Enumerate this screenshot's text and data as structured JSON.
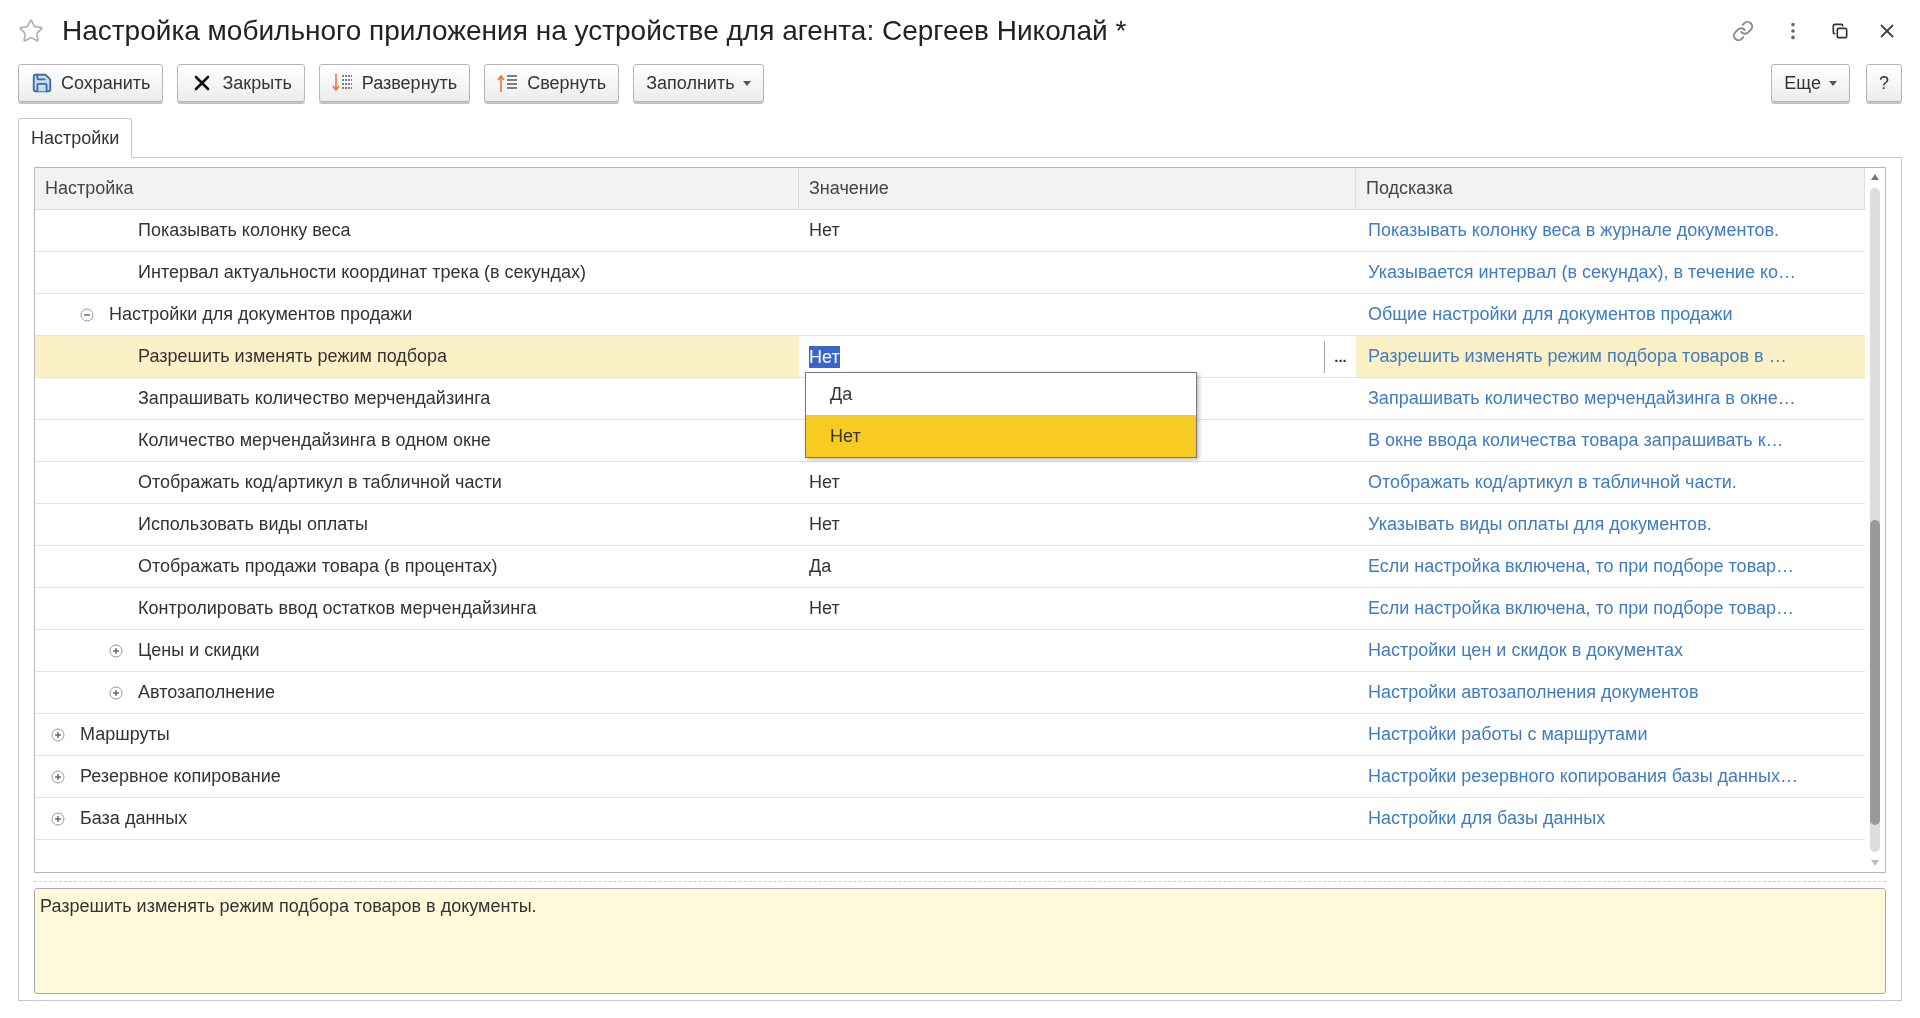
{
  "window": {
    "title": "Настройка мобильного приложения на устройстве для агента: Сергеев Николай *"
  },
  "toolbar": {
    "left": [
      {
        "kind": "save",
        "label": "Сохранить"
      },
      {
        "kind": "close",
        "label": "Закрыть"
      },
      {
        "kind": "expand",
        "label": "Развернуть"
      },
      {
        "kind": "collapse",
        "label": "Свернуть"
      },
      {
        "kind": "menu",
        "label": "Заполнить"
      }
    ],
    "right": [
      {
        "kind": "menu",
        "label": "Еще"
      },
      {
        "kind": "plain",
        "label": "?"
      }
    ]
  },
  "tabs": [
    {
      "label": "Настройки",
      "selected": true
    }
  ],
  "table": {
    "columns": [
      "Настройка",
      "Значение",
      "Подсказка"
    ],
    "rows": [
      {
        "children": [
          {
            "children": [
              {
                "setting": "Показывать колонку веса",
                "value": "Нет",
                "hint": "Показывать колонку веса в журнале документов.",
                "selected": false
              },
              {
                "setting": "Интервал актуальности координат трека (в секундах)",
                "hint": "Указывается интервал (в секундах), в течение ко…",
                "selected": false
              }
            ]
          },
          {
            "setting": "Настройки для документов продажи",
            "hint": "Общие настройки для документов продажи",
            "expanded": true,
            "selected": false,
            "children": [
              {
                "setting": "Разрешить изменять режим подбора",
                "value": "Нет",
                "hint": "Разрешить изменять режим подбора товаров в …",
                "selected": true,
                "editor": {
                  "button": "...",
                  "options": [
                    {
                      "label": "Да",
                      "selected": false
                    },
                    {
                      "label": "Нет",
                      "selected": true
                    }
                  ]
                }
              },
              {
                "setting": "Запрашивать количество мерчендайзинга",
                "hint": "Запрашивать количество мерчендайзинга в окне…",
                "selected": false
              },
              {
                "setting": "Количество мерчендайзинга в одном окне",
                "hint": "В окне ввода количества товара запрашивать к…",
                "selected": false
              },
              {
                "setting": "Отображать код/артикул в табличной части",
                "value": "Нет",
                "hint": "Отображать код/артикул в табличной части.",
                "selected": false
              },
              {
                "setting": "Использовать виды оплаты",
                "value": "Нет",
                "hint": "Указывать виды оплаты для документов.",
                "selected": false
              },
              {
                "setting": "Отображать продажи товара (в процентах)",
                "value": "Да",
                "hint": "Если настройка включена, то при подборе товар…",
                "selected": false
              },
              {
                "setting": "Контролировать ввод остатков мерчендайзинга",
                "value": "Нет",
                "hint": "Если настройка включена, то при подборе товар…",
                "selected": false
              },
              {
                "setting": "Цены и скидки",
                "hint": "Настройки цен и скидок в документах",
                "expanded": false,
                "selected": false
              },
              {
                "setting": "Автозаполнение",
                "hint": "Настройки автозаполнения документов",
                "expanded": false,
                "selected": false
              }
            ]
          }
        ]
      },
      {
        "setting": "Маршруты",
        "hint": "Настройки работы с маршрутами",
        "expanded": false,
        "selected": false
      },
      {
        "setting": "Резервное копирование",
        "hint": "Настройки резервного копирования базы данных…",
        "expanded": false,
        "selected": false
      },
      {
        "setting": "База данных",
        "hint": "Настройки для базы данных",
        "expanded": false,
        "selected": false
      }
    ]
  },
  "description": "Разрешить изменять режим подбора товаров в документы."
}
